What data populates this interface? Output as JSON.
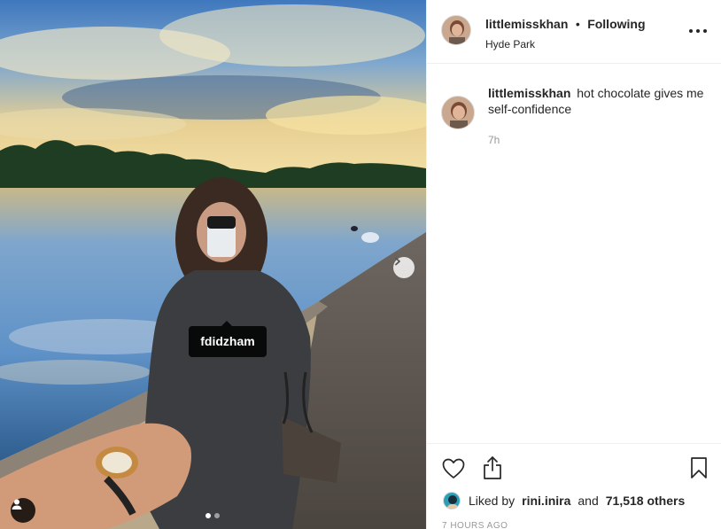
{
  "post": {
    "photo": {
      "user_tag": "fdidzham",
      "carousel_total": 2,
      "carousel_active": 1,
      "icons": {
        "next": "chevron-right-icon",
        "tagged_users": "person-icon"
      }
    },
    "header": {
      "username": "littlemisskhan",
      "separator": "•",
      "follow_status": "Following",
      "location": "Hyde Park",
      "more_icon": "ellipsis-icon"
    },
    "caption": {
      "username": "littlemisskhan",
      "text": "hot chocolate gives me self-confidence",
      "age": "7h"
    },
    "actions": {
      "like_icon": "heart-icon",
      "share_icon": "share-icon",
      "save_icon": "bookmark-icon"
    },
    "likes": {
      "prefix": "Liked by",
      "first_user": "rini.inira",
      "conjunction": "and",
      "others": "71,518 others"
    },
    "timestamp": "7 HOURS AGO"
  },
  "colors": {
    "text": "#262626",
    "muted": "#999999",
    "border": "#efefef"
  }
}
